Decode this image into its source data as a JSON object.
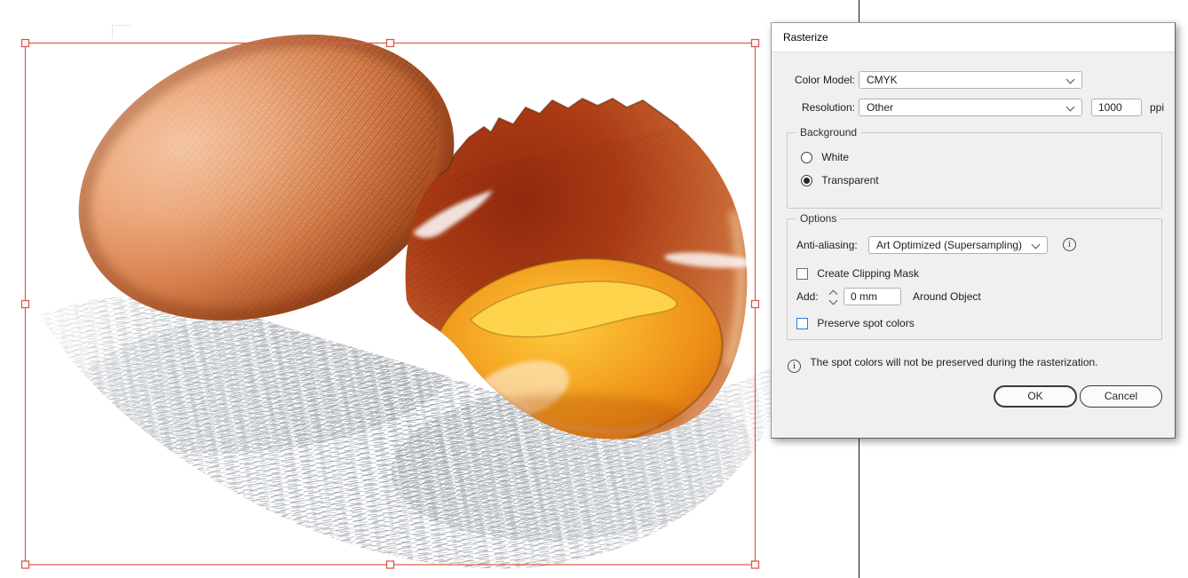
{
  "dialog": {
    "title": "Rasterize",
    "color_model": {
      "label": "Color Model:",
      "value": "CMYK"
    },
    "resolution": {
      "label": "Resolution:",
      "value": "Other",
      "ppi_value": "1000",
      "ppi_unit": "ppi"
    },
    "background": {
      "legend": "Background",
      "white_label": "White",
      "transparent_label": "Transparent",
      "selected": "Transparent"
    },
    "options": {
      "legend": "Options",
      "anti_aliasing_label": "Anti-aliasing:",
      "anti_aliasing_value": "Art Optimized (Supersampling)",
      "clipping_mask_label": "Create Clipping Mask",
      "clipping_mask_checked": false,
      "add_label": "Add:",
      "add_value": "0 mm",
      "add_suffix": "Around Object",
      "preserve_label": "Preserve spot colors",
      "preserve_checked": false,
      "info_icon": "i"
    },
    "info_message": "The spot colors will not be preserved during the rasterization.",
    "info_icon": "i",
    "ok_label": "OK",
    "cancel_label": "Cancel"
  },
  "canvas": {
    "selection_color": "#E5544B",
    "focus_blue": "#2E7CD6",
    "artwork": "egg-illustration"
  }
}
